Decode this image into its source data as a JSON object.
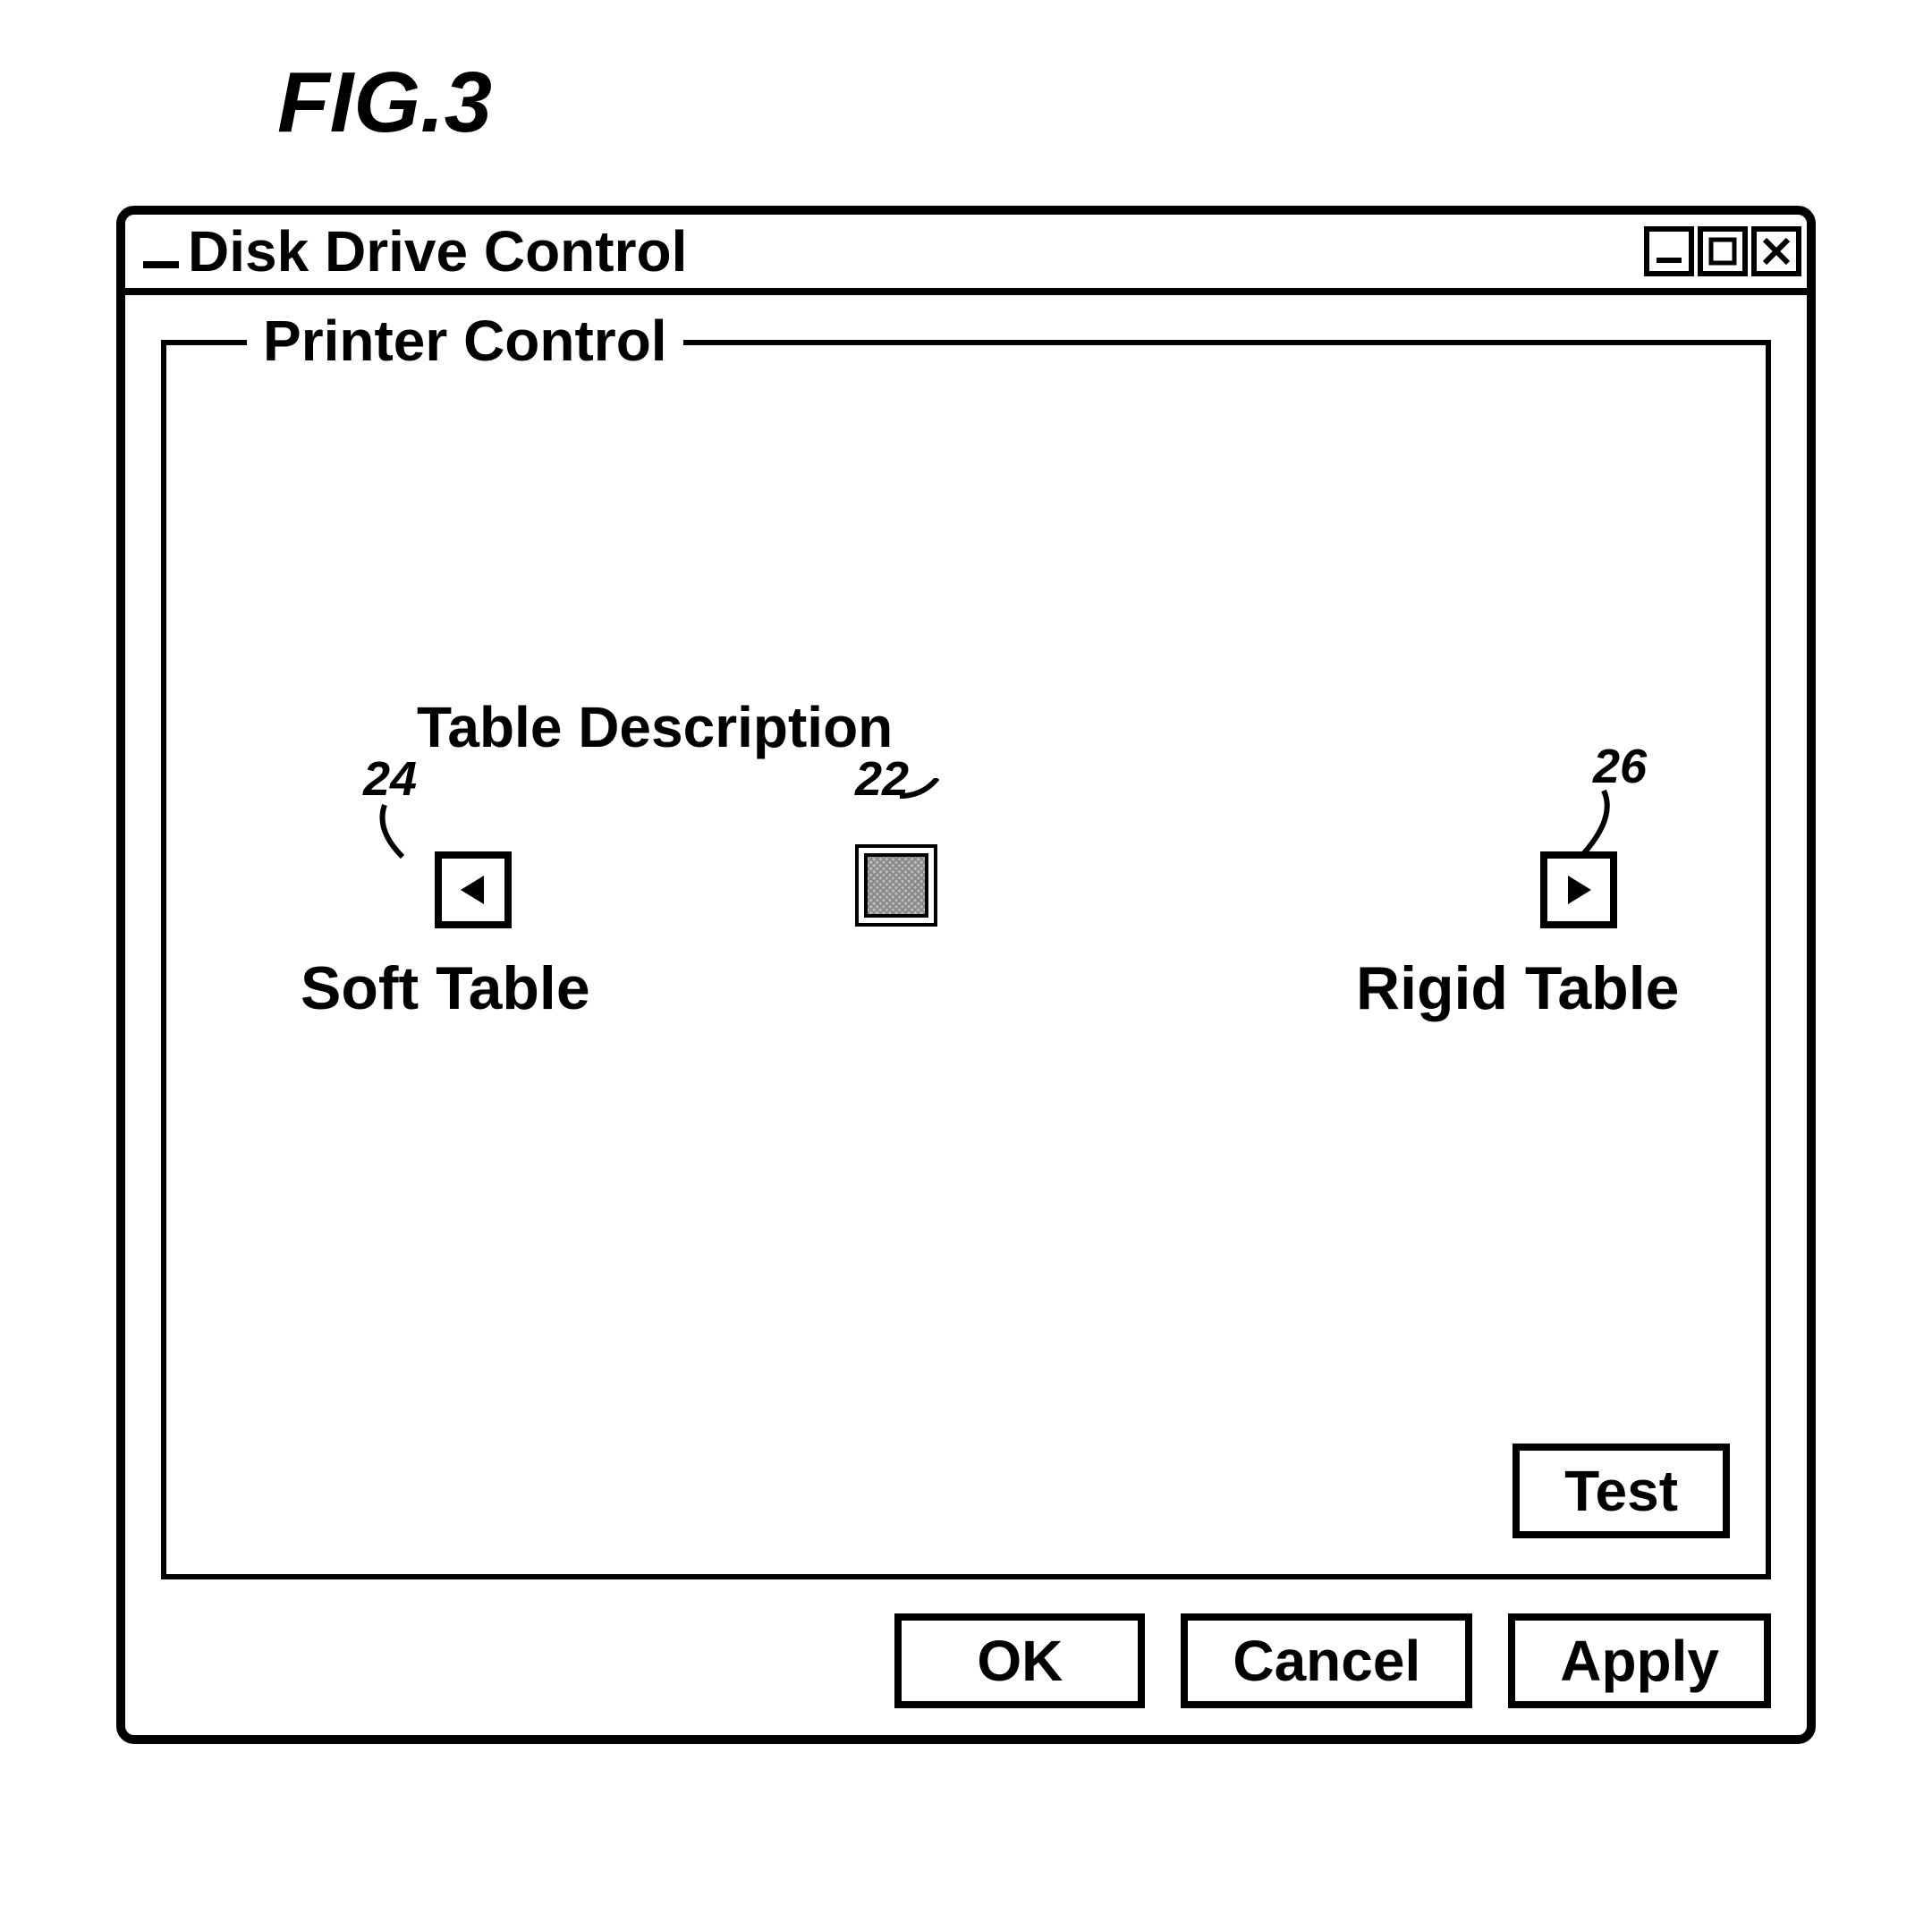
{
  "figure": "FIG.3",
  "window": {
    "title": "Disk Drive Control"
  },
  "group": {
    "legend": "Printer Control"
  },
  "labels": {
    "tableDescription": "Table Description",
    "softTable": "Soft Table",
    "rigidTable": "Rigid Table"
  },
  "callouts": {
    "leftArrow": "24",
    "sliderThumb": "22",
    "rightArrow": "26"
  },
  "buttons": {
    "test": "Test",
    "ok": "OK",
    "cancel": "Cancel",
    "apply": "Apply"
  }
}
